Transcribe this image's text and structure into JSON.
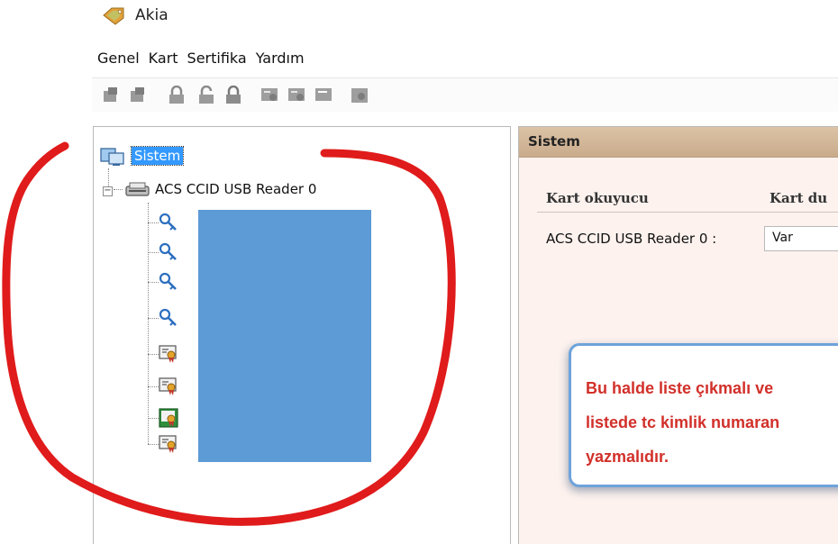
{
  "window": {
    "title": "Akia",
    "icon": "tag-app-icon"
  },
  "menu": {
    "items": [
      "Genel",
      "Kart",
      "Sertifika",
      "Yardım"
    ]
  },
  "toolbar": {
    "buttons": [
      "card-reader-icon",
      "card-reader-icon",
      "lock-icon",
      "unlock-icon",
      "lock-icon",
      "certificate-icon",
      "certificate-icon",
      "certificate-icon",
      "certificate-icon"
    ]
  },
  "tree": {
    "root": {
      "label": "Sistem",
      "icon": "computer-icon"
    },
    "reader": {
      "label": "ACS CCID USB Reader 0",
      "icon": "card-reader-icon",
      "expander": "−"
    },
    "children": [
      {
        "icon": "key-icon"
      },
      {
        "icon": "key-icon"
      },
      {
        "icon": "key-icon"
      },
      {
        "icon": "key-icon"
      },
      {
        "icon": "certificate-icon"
      },
      {
        "icon": "certificate-icon"
      },
      {
        "icon": "certificate-icon"
      },
      {
        "icon": "certificate-icon"
      }
    ],
    "redaction_color": "#5c9bd5"
  },
  "panel": {
    "title": "Sistem",
    "columns": [
      "Kart okuyucu",
      "Kart du"
    ],
    "row": {
      "label": "ACS CCID USB Reader 0 :",
      "value": "Var"
    }
  },
  "callout": {
    "lines": [
      "Bu halde liste çıkmalı ve",
      "listede tc kimlik numaran",
      "yazmalıdır."
    ],
    "text_color": "#d2302a"
  },
  "annotation": {
    "color": "#e01b1b"
  }
}
